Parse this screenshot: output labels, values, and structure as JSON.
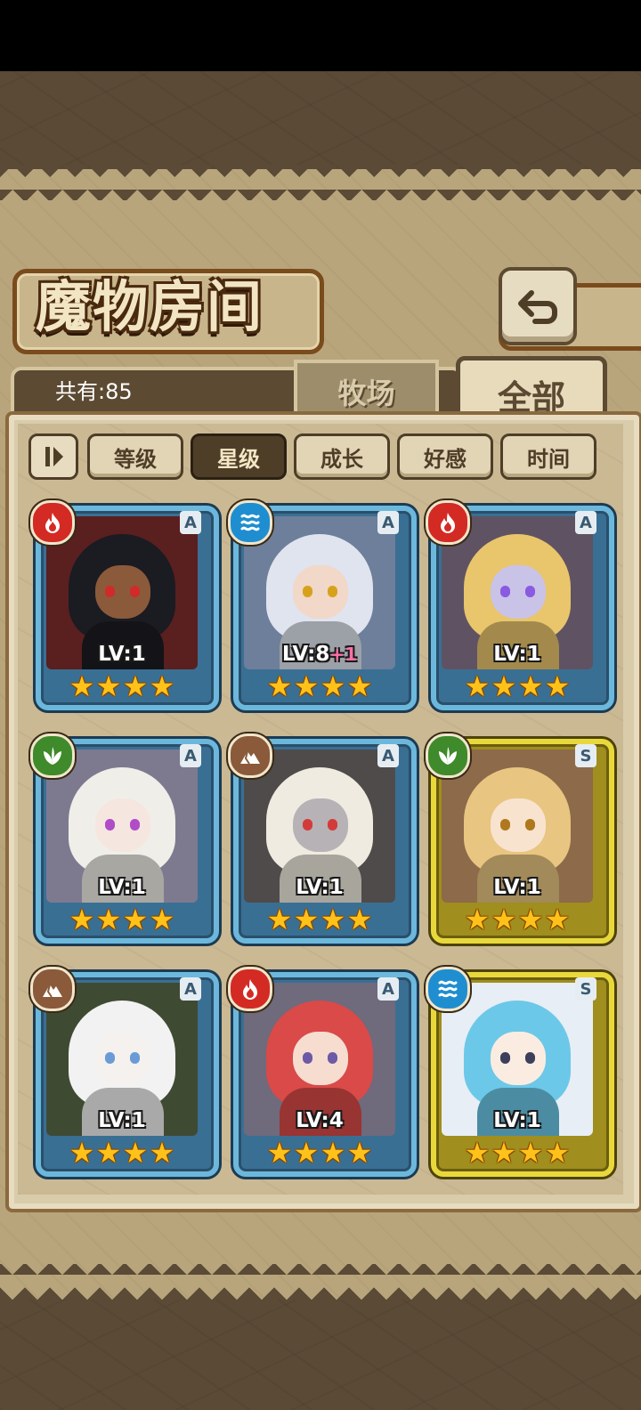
{
  "header": {
    "title": "魔物房间"
  },
  "count": {
    "label": "共有:85"
  },
  "tabs": [
    {
      "label": "牧场",
      "active": false
    },
    {
      "label": "全部",
      "active": true
    }
  ],
  "sort": [
    {
      "label": "等级",
      "active": false
    },
    {
      "label": "星级",
      "active": true
    },
    {
      "label": "成长",
      "active": false
    },
    {
      "label": "好感",
      "active": false
    },
    {
      "label": "时间",
      "active": false
    }
  ],
  "monsters": [
    {
      "element": "fire",
      "rank": "A",
      "level": "LV:1",
      "bonus": "",
      "stars": 4,
      "frame": "blue",
      "hair": "#1b1b22",
      "skin": "#8b5a3a",
      "eye": "#d12a2a",
      "bg": "#5a1f1f"
    },
    {
      "element": "water",
      "rank": "A",
      "level": "LV:8",
      "bonus": "+1",
      "stars": 4,
      "frame": "blue",
      "hair": "#dfe4ef",
      "skin": "#f1d8c8",
      "eye": "#d7a21b",
      "bg": "#6d7f9a"
    },
    {
      "element": "fire",
      "rank": "A",
      "level": "LV:1",
      "bonus": "",
      "stars": 4,
      "frame": "blue",
      "hair": "#e9c56c",
      "skin": "#c9c3e8",
      "eye": "#8a5ae0",
      "bg": "#5f5363"
    },
    {
      "element": "wood",
      "rank": "A",
      "level": "LV:1",
      "bonus": "",
      "stars": 4,
      "frame": "blue",
      "hair": "#f0eee8",
      "skin": "#f6e6e0",
      "eye": "#b04cc7",
      "bg": "#7d7a90"
    },
    {
      "element": "earth",
      "rank": "A",
      "level": "LV:1",
      "bonus": "",
      "stars": 4,
      "frame": "blue",
      "hair": "#f0ebe0",
      "skin": "#b7b2b5",
      "eye": "#d33b3b",
      "bg": "#4f4b4b"
    },
    {
      "element": "wood",
      "rank": "S",
      "level": "LV:1",
      "bonus": "",
      "stars": 4,
      "frame": "gold",
      "hair": "#e8c581",
      "skin": "#f8e3cf",
      "eye": "#b0781d",
      "bg": "#8c6a4a"
    },
    {
      "element": "earth",
      "rank": "A",
      "level": "LV:1",
      "bonus": "",
      "stars": 4,
      "frame": "blue",
      "hair": "#f2f2f2",
      "skin": "#f4f1ee",
      "eye": "#6b9bd6",
      "bg": "#3f4a33"
    },
    {
      "element": "fire",
      "rank": "A",
      "level": "LV:4",
      "bonus": "",
      "stars": 4,
      "frame": "blue",
      "hair": "#d94a48",
      "skin": "#f7ddd0",
      "eye": "#6d5aa6",
      "bg": "#6f6a7c"
    },
    {
      "element": "water",
      "rank": "S",
      "level": "LV:1",
      "bonus": "",
      "stars": 4,
      "frame": "gold",
      "hair": "#6cc8e8",
      "skin": "#fbece2",
      "eye": "#3d3d5c",
      "bg": "#e7eef5"
    }
  ],
  "colors": {
    "fire": "#d42a24",
    "water": "#1f8ed0",
    "wood": "#3f8a2a",
    "earth": "#8a5a3a",
    "star": "#ffc21a"
  },
  "icons": {
    "back": "return-arrow-icon",
    "sort_toggle": "sort-order-icon",
    "fire": "flame-icon",
    "water": "wave-icon",
    "wood": "leaf-icon",
    "earth": "mountain-icon",
    "star": "star-icon"
  }
}
